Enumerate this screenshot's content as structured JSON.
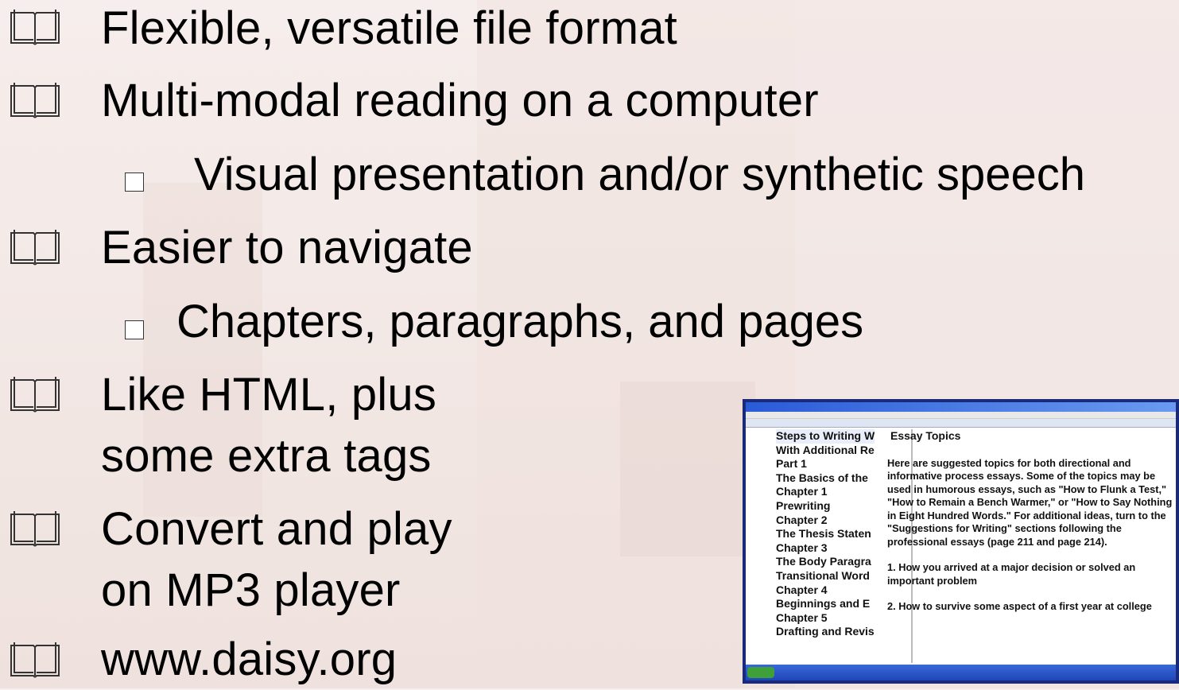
{
  "bullets": [
    {
      "icon": "book-icon",
      "text": "Flexible, versatile file format"
    },
    {
      "icon": "book-icon",
      "text": "Multi-modal reading on a computer"
    },
    {
      "icon": "book-icon",
      "text": "Easier to navigate"
    },
    {
      "icon": "book-icon",
      "text": "Like HTML, plus",
      "text2": "some extra tags"
    },
    {
      "icon": "book-icon",
      "text": "Convert and play",
      "text2": "on MP3 player"
    },
    {
      "icon": "book-icon",
      "text": "www.daisy.org"
    }
  ],
  "subbullets": [
    {
      "icon": "square-bullet-icon",
      "text": "Visual presentation and/or synthetic speech"
    },
    {
      "icon": "square-bullet-icon",
      "text": "Chapters, paragraphs, and pages"
    }
  ],
  "screenshot": {
    "tree": [
      "Steps to Writing W",
      "With Additional Re",
      "Part 1",
      "The Basics of the",
      "Chapter 1",
      "Prewriting",
      "Chapter 2",
      "The Thesis Staten",
      "Chapter 3",
      "The Body Paragra",
      "Transitional Word",
      "Chapter 4",
      "Beginnings and E",
      "Chapter 5",
      "Drafting and Revis"
    ],
    "heading": "Essay Topics",
    "paragraph": "Here are suggested topics for both directional and informative process essays. Some of the topics may be used in humorous essays, such as \"How to Flunk a Test,\" \"How to Remain a Bench Warmer,\" or \"How to Say Nothing in Eight Hundred Words.\" For additional ideas, turn to the \"Suggestions for Writing\" sections following the professional essays (page 211 and page 214).",
    "item1": "1.  How you arrived at a major decision or solved an important problem",
    "item2": "2.  How to survive some aspect of a first year at college"
  },
  "colors": {
    "text": "#000000",
    "frame": "#1a2a7a",
    "taskbar": "#2453c9"
  }
}
